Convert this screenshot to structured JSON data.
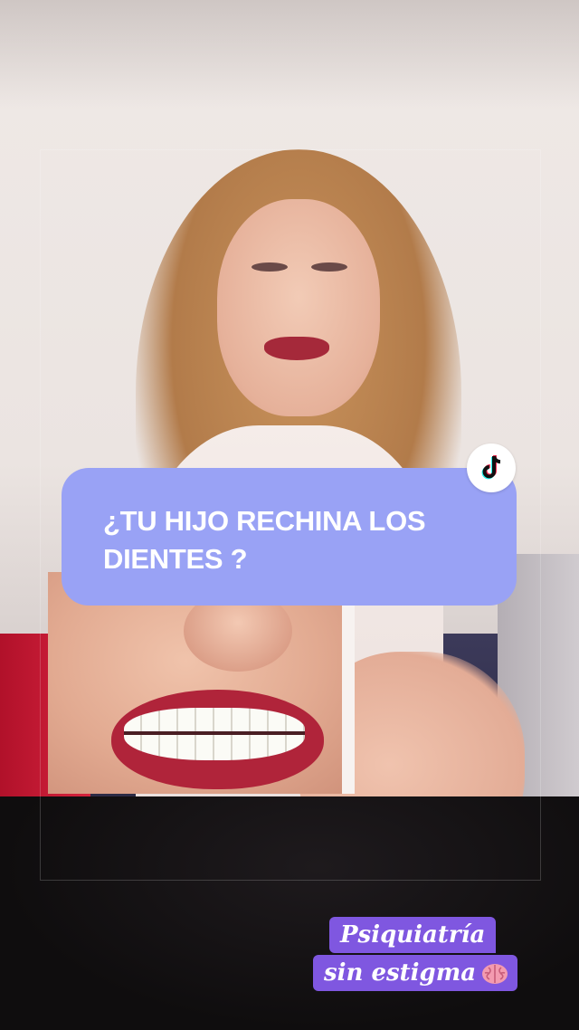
{
  "headline": {
    "text": "¿TU HIJO RECHINA LOS DIENTES ?"
  },
  "platform_badge": {
    "icon": "tiktok-icon"
  },
  "tag": {
    "line1": "Psiquiatría",
    "line2": "sin estigma",
    "emoji_icon": "brain-icon"
  },
  "colors": {
    "headline_card": "#99a2f5",
    "tag_background": "#7f57e0",
    "text": "#ffffff"
  }
}
